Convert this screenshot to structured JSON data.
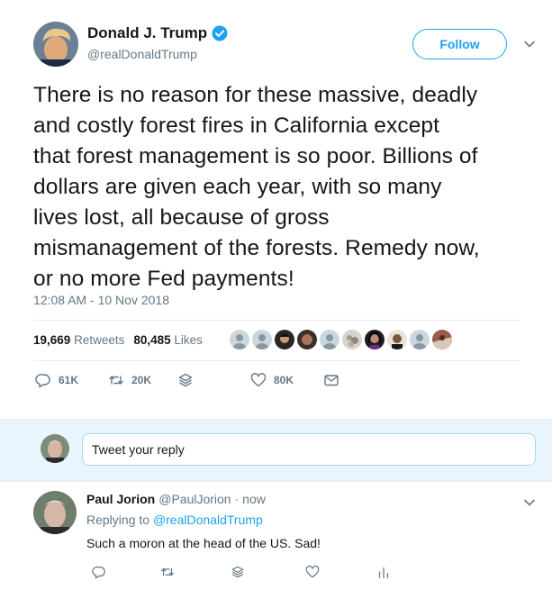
{
  "tweet": {
    "display_name": "Donald J. Trump",
    "handle": "@realDonaldTrump",
    "follow_label": "Follow",
    "text": "There is no reason for these massive, deadly\nand costly forest fires in California except\nthat forest management is so poor. Billions of\ndollars are given each year, with so many\nlives lost, all because of gross\nmismanagement of the forests. Remedy now,\nor no more Fed payments!",
    "timestamp": "12:08 AM - 10 Nov 2018",
    "retweets_count": "19,669",
    "retweets_label": "Retweets",
    "likes_count": "80,485",
    "likes_label": "Likes",
    "liker_count": 10,
    "actions": {
      "replies": "61K",
      "retweets": "20K",
      "likes": "80K"
    },
    "verified_icon": "verified-badge-icon"
  },
  "reply_box": {
    "placeholder": "Tweet your reply"
  },
  "reply": {
    "display_name": "Paul Jorion",
    "handle": "@PaulJorion",
    "time": "· now",
    "replying_prefix": "Replying to",
    "replying_to": "@realDonaldTrump",
    "text": "Such a moron at the head of the US. Sad!"
  },
  "colors": {
    "accent": "#1da1f2",
    "muted": "#657786",
    "reply_bg": "#e8f5fd"
  }
}
